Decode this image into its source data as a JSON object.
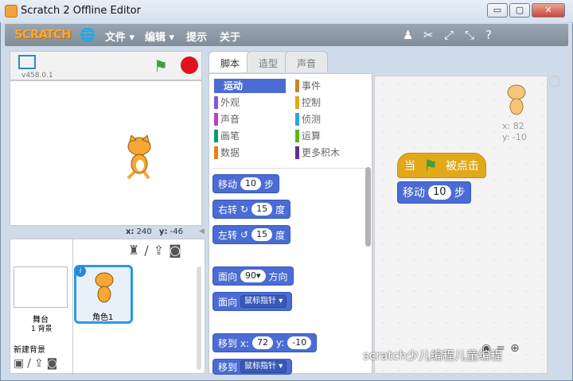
{
  "window": {
    "title": "Scratch 2 Offline Editor",
    "min": "▭",
    "max": "▢",
    "close": "✕"
  },
  "menubar": {
    "logo": "SCRATCH",
    "file": "文件 ▾",
    "edit": "编辑 ▾",
    "tips": "提示",
    "about": "关于"
  },
  "stage": {
    "version": "v458.0.1",
    "x_label": "x:",
    "x": "240",
    "y_label": "y:",
    "y": "-46"
  },
  "sprites_panel": {
    "stage_label": "舞台",
    "backdrop_count": "1 背景",
    "new_backdrop": "新建背景",
    "sprite1": "角色1"
  },
  "tabs": [
    "脚本",
    "造型",
    "声音"
  ],
  "categories": {
    "left": [
      {
        "label": "运动",
        "color": "#4a6cd4"
      },
      {
        "label": "外观",
        "color": "#8a55d7"
      },
      {
        "label": "声音",
        "color": "#bb42c3"
      },
      {
        "label": "画笔",
        "color": "#0e9a6c"
      },
      {
        "label": "数据",
        "color": "#ee7d16"
      }
    ],
    "right": [
      {
        "label": "事件",
        "color": "#c88330"
      },
      {
        "label": "控制",
        "color": "#e1a91a"
      },
      {
        "label": "侦测",
        "color": "#2ca5e2"
      },
      {
        "label": "运算",
        "color": "#5cb712"
      },
      {
        "label": "更多积木",
        "color": "#632d99"
      }
    ]
  },
  "blocks": {
    "move": "移动",
    "move_steps": "10",
    "move_suffix": "步",
    "turn_right": "右转",
    "turn_right_deg": "15",
    "degree": "度",
    "turn_left": "左转",
    "turn_left_deg": "15",
    "point_dir": "面向",
    "dir_val": "90▾",
    "dir_suffix": "方向",
    "point_towards": "面向",
    "towards_val": "鼠标指针 ▾",
    "goto_xy": "移到 x:",
    "goto_x": "72",
    "goto_y_label": "y:",
    "goto_y": "-10",
    "goto": "移到",
    "goto_val": "鼠标指针 ▾"
  },
  "script": {
    "hat": "当",
    "hat_suffix": "被点击",
    "move": "移动",
    "move_steps": "10",
    "move_suffix": "步",
    "sprite_x": "x: 82",
    "sprite_y": "y: -10"
  },
  "watermark": "scratch少儿编程儿童编程"
}
